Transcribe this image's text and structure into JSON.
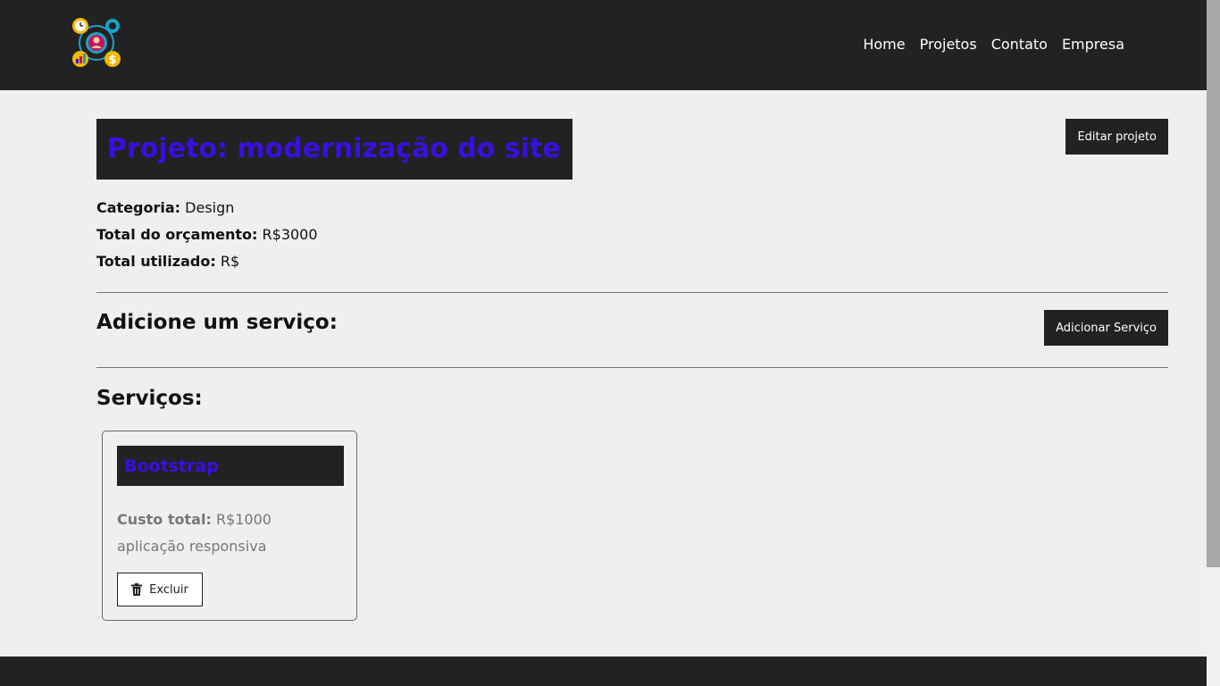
{
  "navbar": {
    "logo_name": "company-logo",
    "items": [
      {
        "label": "Home"
      },
      {
        "label": "Projetos"
      },
      {
        "label": "Contato"
      },
      {
        "label": "Empresa"
      }
    ]
  },
  "project": {
    "title": "Projeto: modernização do site",
    "edit_button": "Editar projeto",
    "category_label": "Categoria:",
    "category_value": "Design",
    "budget_label": "Total do orçamento:",
    "budget_value": "R$3000",
    "used_label": "Total utilizado:",
    "used_value": "R$"
  },
  "add_service": {
    "heading": "Adicione um serviço:",
    "button": "Adicionar Serviço"
  },
  "services": {
    "heading": "Serviços:",
    "items": [
      {
        "name": "Bootstrap",
        "cost_label": "Custo total:",
        "cost_value": "R$1000",
        "description": "aplicação responsiva",
        "delete_label": "Excluir"
      }
    ]
  },
  "colors": {
    "dark": "#222222",
    "accent": "#3810e0",
    "background": "#efefef"
  },
  "icons": {
    "delete": "trash-icon"
  }
}
